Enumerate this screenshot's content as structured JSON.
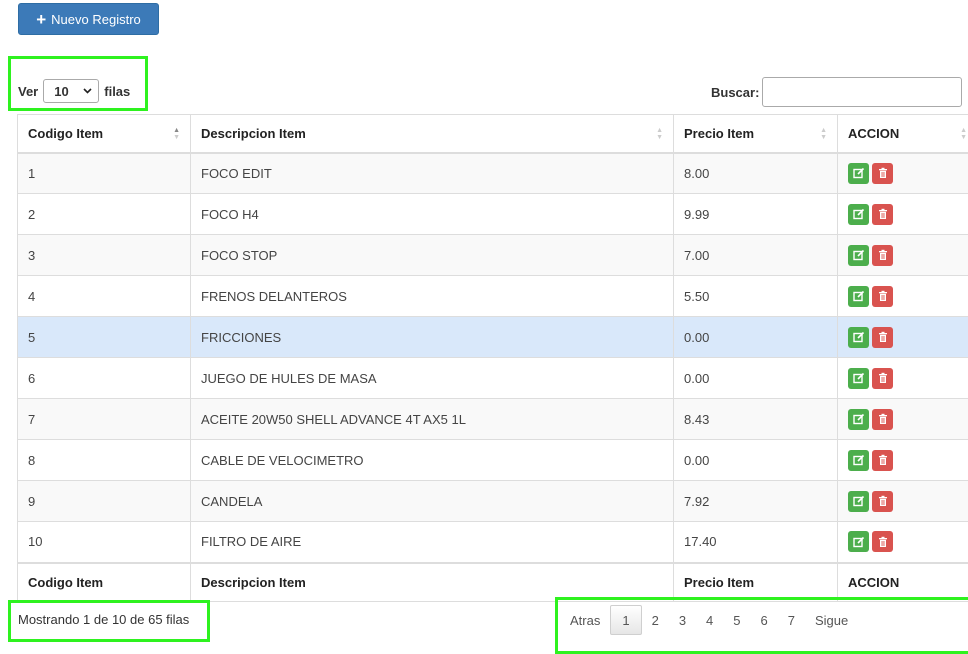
{
  "toolbar": {
    "new_button_icon": "plus-icon",
    "new_button_label": "Nuevo Registro",
    "accent": "#337ab7"
  },
  "length": {
    "prefix": "Ver",
    "value": "10",
    "suffix": "filas"
  },
  "search": {
    "label": "Buscar:",
    "value": ""
  },
  "table": {
    "headers": [
      "Codigo Item",
      "Descripcion Item",
      "Precio Item",
      "ACCION"
    ],
    "rows": [
      {
        "code": "1",
        "desc": "FOCO EDIT",
        "price": "8.00"
      },
      {
        "code": "2",
        "desc": "FOCO H4",
        "price": "9.99"
      },
      {
        "code": "3",
        "desc": "FOCO STOP",
        "price": "7.00"
      },
      {
        "code": "4",
        "desc": "FRENOS DELANTEROS",
        "price": "5.50"
      },
      {
        "code": "5",
        "desc": "FRICCIONES",
        "price": "0.00",
        "selected": true
      },
      {
        "code": "6",
        "desc": "JUEGO DE HULES DE MASA",
        "price": "0.00"
      },
      {
        "code": "7",
        "desc": "ACEITE 20W50 SHELL ADVANCE 4T AX5 1L",
        "price": "8.43"
      },
      {
        "code": "8",
        "desc": "CABLE DE VELOCIMETRO",
        "price": "0.00"
      },
      {
        "code": "9",
        "desc": "CANDELA",
        "price": "7.92"
      },
      {
        "code": "10",
        "desc": "FILTRO DE AIRE",
        "price": "17.40"
      }
    ],
    "action_icons": [
      "edit-icon",
      "trash-icon"
    ],
    "colors": {
      "edit": "#5cb85c",
      "delete": "#d9534f",
      "selected_row": "#d9e8fa"
    }
  },
  "info": "Mostrando 1 de 10 de 65 filas",
  "pagination": {
    "prev": "Atras",
    "pages": [
      "1",
      "2",
      "3",
      "4",
      "5",
      "6",
      "7"
    ],
    "current": "1",
    "next": "Sigue"
  },
  "highlight_color": "#2ef21f"
}
